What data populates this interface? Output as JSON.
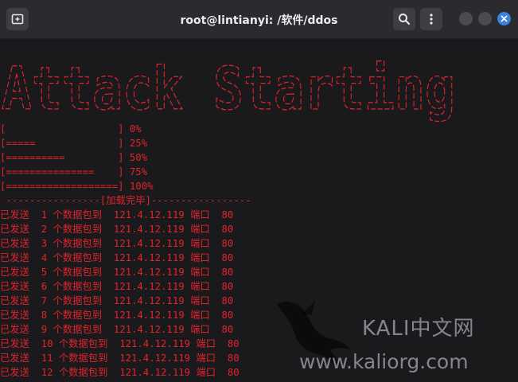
{
  "window": {
    "title": "root@lintianyi: /软件/ddos",
    "accent": "#3b82e0"
  },
  "terminal": {
    "text_color": "#e0242c",
    "banner_text": "Attack Starting",
    "progress": [
      {
        "bar": "[                   ]",
        "label": "0%"
      },
      {
        "bar": "[=====              ]",
        "label": "25%"
      },
      {
        "bar": "[==========         ]",
        "label": "50%"
      },
      {
        "bar": "[===============    ]",
        "label": "75%"
      },
      {
        "bar": "[===================]",
        "label": "100%"
      }
    ],
    "separator": " ----------------[加载完毕]-----------------",
    "sent_lines": [
      "已发送  1 个数据包到  121.4.12.119 端口  80",
      "已发送  2 个数据包到  121.4.12.119 端口  80",
      "已发送  3 个数据包到  121.4.12.119 端口  80",
      "已发送  4 个数据包到  121.4.12.119 端口  80",
      "已发送  5 个数据包到  121.4.12.119 端口  80",
      "已发送  6 个数据包到  121.4.12.119 端口  80",
      "已发送  7 个数据包到  121.4.12.119 端口  80",
      "已发送  8 个数据包到  121.4.12.119 端口  80",
      "已发送  9 个数据包到  121.4.12.119 端口  80",
      "已发送  10 个数据包到  121.4.12.119 端口  80",
      "已发送  11 个数据包到  121.4.12.119 端口  80",
      "已发送  12 个数据包到  121.4.12.119 端口  80"
    ]
  },
  "watermark": {
    "brand": "KALI中文网",
    "url": "www.kaliorg.com"
  },
  "icons": {
    "new_tab": "new-tab-icon",
    "search": "search-icon",
    "menu": "menu-icon",
    "close": "close-icon"
  }
}
